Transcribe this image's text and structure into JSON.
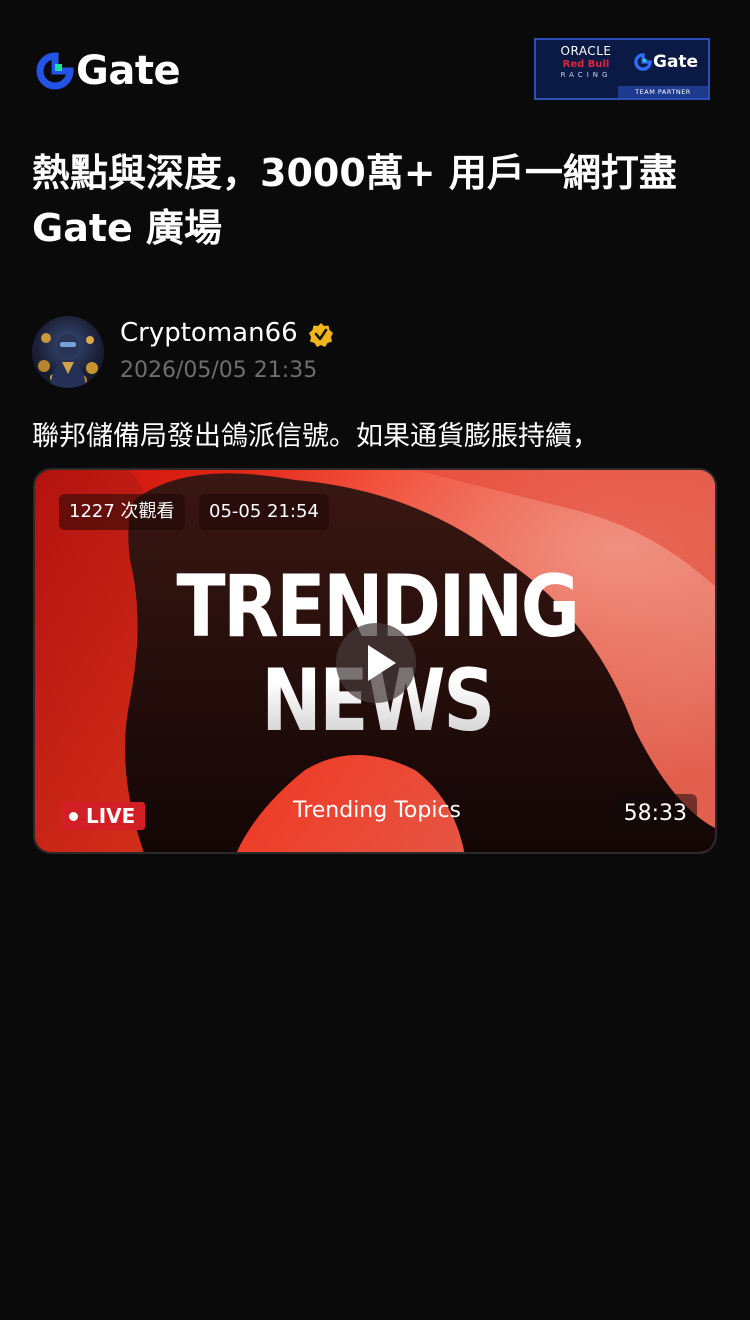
{
  "header": {
    "logo_text": "Gate",
    "partner": {
      "line1": "ORACLE",
      "line2": "Red Bull",
      "line3": "RACING",
      "gate_text": "Gate",
      "team_label": "TEAM PARTNER"
    }
  },
  "headline": {
    "line1": "熱點與深度，3000萬+ 用戶一網打盡",
    "line2": "Gate 廣場"
  },
  "post": {
    "username": "Cryptoman66",
    "timestamp": "2026/05/05 21:35",
    "text": "聯邦儲備局發出鴿派信號。如果通貨膨脹持續，",
    "verified_icon": "verified-badge-icon"
  },
  "video": {
    "views": "1227 次觀看",
    "start_time": "05-05 21:54",
    "title_line1": "TRENDING",
    "title_line2": "NEWS",
    "live_label": "LIVE",
    "topics_label": "Trending Topics",
    "duration": "58:33",
    "play_icon": "play-icon"
  },
  "colors": {
    "background": "#0a0a0a",
    "accent_blue": "#2354e6",
    "accent_green": "#17e6a1",
    "live_red": "#d21f26",
    "verified_gold": "#f2b51d",
    "timestamp_gray": "#6e6e6e"
  }
}
